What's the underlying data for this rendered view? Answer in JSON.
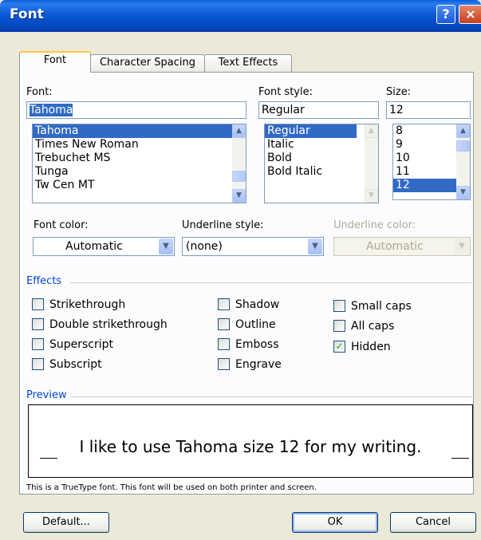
{
  "window": {
    "title": "Font",
    "help_glyph": "?",
    "close_glyph": "×"
  },
  "tabs": [
    {
      "label": "Font",
      "active": true
    },
    {
      "label": "Character Spacing",
      "active": false
    },
    {
      "label": "Text Effects",
      "active": false
    }
  ],
  "font": {
    "label": "Font:",
    "value": "Tahoma",
    "list": [
      "Tahoma",
      "Times New Roman",
      "Trebuchet MS",
      "Tunga",
      "Tw Cen MT"
    ],
    "selected": "Tahoma"
  },
  "font_style": {
    "label": "Font style:",
    "value": "Regular",
    "list": [
      "Regular",
      "Italic",
      "Bold",
      "Bold Italic"
    ],
    "selected": "Regular"
  },
  "size": {
    "label": "Size:",
    "value": "12",
    "list": [
      "8",
      "9",
      "10",
      "11",
      "12"
    ],
    "selected": "12"
  },
  "font_color": {
    "label": "Font color:",
    "value": "Automatic"
  },
  "underline_style": {
    "label": "Underline style:",
    "value": "(none)"
  },
  "underline_color": {
    "label": "Underline color:",
    "value": "Automatic",
    "disabled": true
  },
  "effects": {
    "heading": "Effects",
    "col1": [
      {
        "label": "Strikethrough",
        "checked": false
      },
      {
        "label": "Double strikethrough",
        "checked": false
      },
      {
        "label": "Superscript",
        "checked": false
      },
      {
        "label": "Subscript",
        "checked": false
      }
    ],
    "col2": [
      {
        "label": "Shadow",
        "checked": false
      },
      {
        "label": "Outline",
        "checked": false
      },
      {
        "label": "Emboss",
        "checked": false
      },
      {
        "label": "Engrave",
        "checked": false
      }
    ],
    "col3": [
      {
        "label": "Small caps",
        "checked": false
      },
      {
        "label": "All caps",
        "checked": false
      },
      {
        "label": "Hidden",
        "checked": true
      }
    ]
  },
  "preview": {
    "heading": "Preview",
    "text": "I like to use Tahoma size 12 for my writing.",
    "note": "This is a TrueType font. This font will be used on both printer and screen."
  },
  "buttons": {
    "default": "Default...",
    "ok": "OK",
    "cancel": "Cancel"
  },
  "colors": {
    "title_bar": "#0a5fd8",
    "selection": "#316ac5",
    "group_heading": "#0046d5",
    "dialog_bg": "#ece9d8"
  }
}
